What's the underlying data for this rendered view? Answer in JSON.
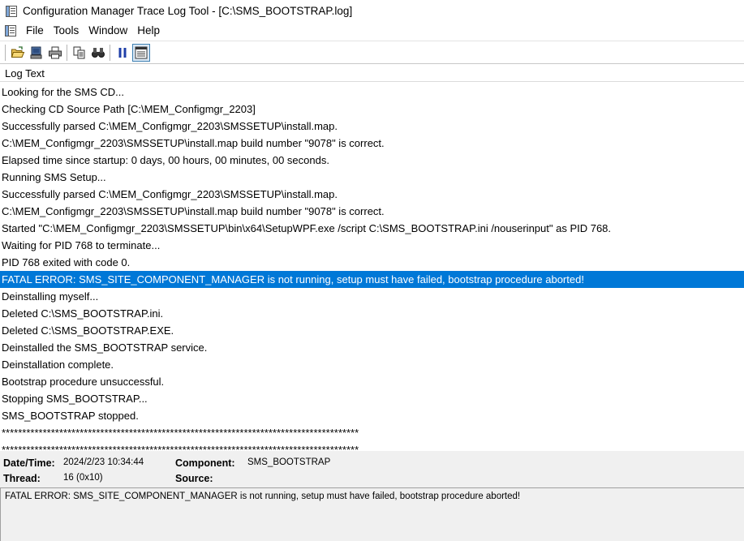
{
  "window": {
    "title": "Configuration Manager Trace Log Tool - [C:\\SMS_BOOTSTRAP.log]"
  },
  "menu": {
    "items": [
      "File",
      "Tools",
      "Window",
      "Help"
    ]
  },
  "toolbar": {
    "buttons": [
      {
        "icon": "open-folder-icon"
      },
      {
        "icon": "open-remote-icon"
      },
      {
        "icon": "print-icon"
      },
      {
        "icon": "copy-icon"
      },
      {
        "icon": "find-icon"
      },
      {
        "icon": "pause-icon"
      },
      {
        "icon": "details-pane-icon",
        "active": true
      }
    ]
  },
  "log": {
    "column_header": "Log Text",
    "rows": [
      "Looking for the SMS CD...",
      "Checking CD Source Path [C:\\MEM_Configmgr_2203]",
      "Successfully parsed C:\\MEM_Configmgr_2203\\SMSSETUP\\install.map.",
      "C:\\MEM_Configmgr_2203\\SMSSETUP\\install.map build number \"9078\" is correct.",
      "Elapsed time since startup: 0 days, 00 hours, 00 minutes, 00 seconds.",
      "Running SMS Setup...",
      "Successfully parsed C:\\MEM_Configmgr_2203\\SMSSETUP\\install.map.",
      "C:\\MEM_Configmgr_2203\\SMSSETUP\\install.map build number \"9078\" is correct.",
      "Started \"C:\\MEM_Configmgr_2203\\SMSSETUP\\bin\\x64\\SetupWPF.exe /script C:\\SMS_BOOTSTRAP.ini /nouserinput\" as PID 768.",
      "Waiting for PID 768 to terminate...",
      "PID 768 exited with code 0.",
      "FATAL ERROR: SMS_SITE_COMPONENT_MANAGER is not running, setup must have failed, bootstrap procedure aborted!",
      "Deinstalling myself...",
      "Deleted C:\\SMS_BOOTSTRAP.ini.",
      "Deleted C:\\SMS_BOOTSTRAP.EXE.",
      "Deinstalled the SMS_BOOTSTRAP service.",
      "Deinstallation complete.",
      "Bootstrap procedure unsuccessful.",
      "Stopping SMS_BOOTSTRAP...",
      "SMS_BOOTSTRAP stopped.",
      "***************************************************************************************",
      "***************************************************************************************"
    ],
    "selected_index": 11
  },
  "details": {
    "datetime_label": "Date/Time:",
    "datetime_value": "2024/2/23 10:34:44",
    "component_label": "Component:",
    "component_value": "SMS_BOOTSTRAP",
    "thread_label": "Thread:",
    "thread_value": "16 (0x10)",
    "source_label": "Source:",
    "source_value": "",
    "message": "FATAL ERROR: SMS_SITE_COMPONENT_MANAGER is not running, setup must have failed, bootstrap procedure aborted!"
  },
  "colors": {
    "selection": "#0078d7",
    "details_background": "#f0f0f0"
  }
}
